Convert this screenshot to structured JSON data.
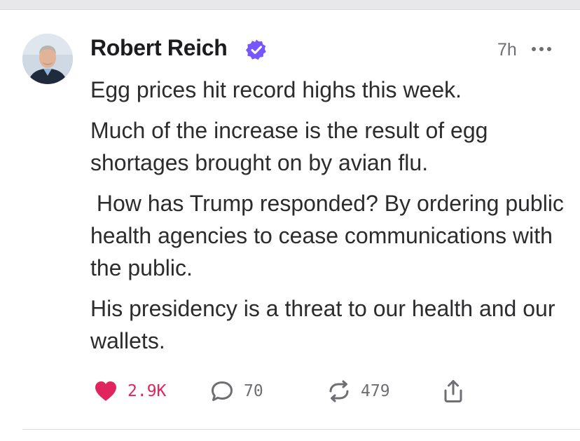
{
  "post": {
    "author": {
      "name": "Robert Reich",
      "verified": true,
      "verified_badge_color": "#7856ff"
    },
    "timestamp": "7h",
    "paragraphs": [
      "Egg prices hit record highs this week.",
      "Much of the increase is the result of egg shortages brought on by avian flu.",
      " How has Trump responded? By ordering public health agencies to cease communications with the public.",
      "His presidency is a threat to our health and our wallets."
    ],
    "actions": {
      "likes": "2.9K",
      "liked": true,
      "like_color": "#e0245e",
      "replies": "70",
      "reposts": "479"
    }
  },
  "icons": {
    "avatar": "author-avatar-photo",
    "verified": "verified-badge-icon",
    "more": "more-options-icon",
    "like": "heart-icon",
    "reply": "comment-bubble-icon",
    "repost": "repost-arrows-icon",
    "share": "share-upload-icon"
  }
}
